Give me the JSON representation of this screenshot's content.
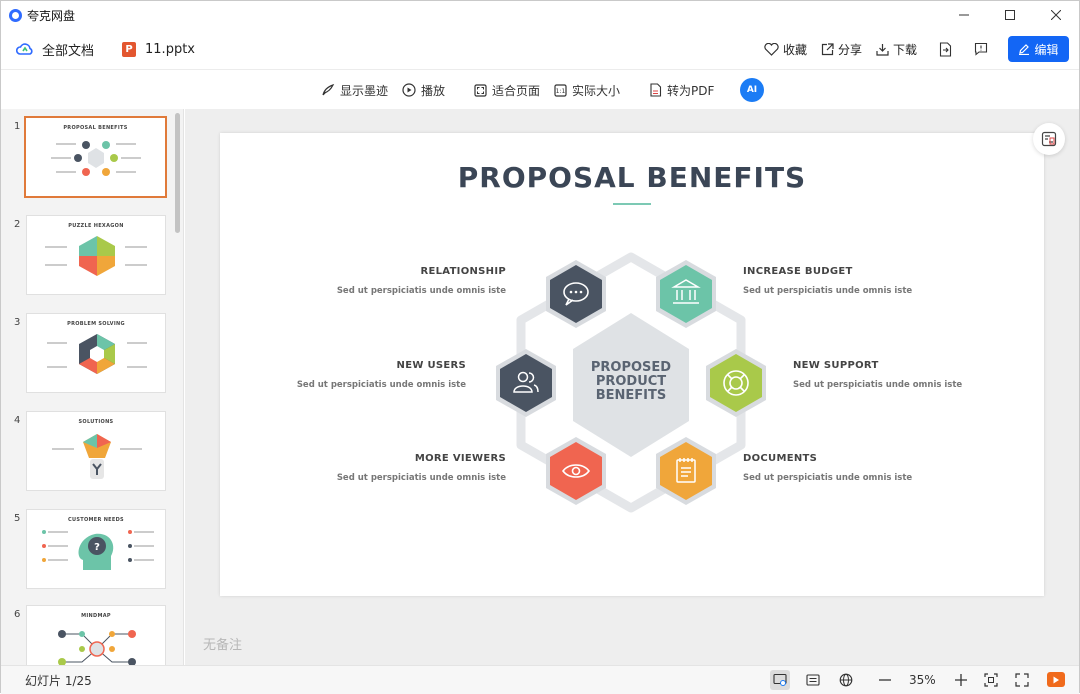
{
  "window": {
    "app_title": "夸克网盘"
  },
  "topbar": {
    "all_docs": "全部文档",
    "file_name": "11.pptx",
    "file_badge": "P",
    "favorite": "收藏",
    "share": "分享",
    "download": "下载",
    "edit": "编辑"
  },
  "toolbar": {
    "show_ink": "显示墨迹",
    "play": "播放",
    "fit_page": "适合页面",
    "actual_size": "实际大小",
    "to_pdf": "转为PDF",
    "ai_label": "AI"
  },
  "thumbnails": [
    {
      "num": "1",
      "title": "PROPOSAL BENEFITS"
    },
    {
      "num": "2",
      "title": "PUZZLE HEXAGON"
    },
    {
      "num": "3",
      "title": "PROBLEM SOLVING"
    },
    {
      "num": "4",
      "title": "SOLUTIONS"
    },
    {
      "num": "5",
      "title": "CUSTOMER NEEDS"
    },
    {
      "num": "6",
      "title": "MINDMAP"
    }
  ],
  "slide": {
    "title": "PROPOSAL BENEFITS",
    "center_line1": "PROPOSED",
    "center_line2": "PRODUCT",
    "center_line3": "BENEFITS",
    "items": {
      "relationship": {
        "title": "RELATIONSHIP",
        "desc": "Sed ut perspiciatis unde omnis iste"
      },
      "increase_budget": {
        "title": "INCREASE BUDGET",
        "desc": "Sed ut perspiciatis unde omnis iste"
      },
      "new_users": {
        "title": "NEW USERS",
        "desc": "Sed ut perspiciatis unde omnis iste"
      },
      "new_support": {
        "title": "NEW SUPPORT",
        "desc": "Sed ut perspiciatis unde omnis iste"
      },
      "more_viewers": {
        "title": "MORE VIEWERS",
        "desc": "Sed ut perspiciatis unde omnis iste"
      },
      "documents": {
        "title": "DOCUMENTS",
        "desc": "Sed ut perspiciatis unde omnis iste"
      }
    }
  },
  "notes_placeholder": "无备注",
  "status": {
    "slide_count": "幻灯片 1/25",
    "zoom": "35%"
  },
  "colors": {
    "accent": "#1366f5",
    "hex_dark": "#4a5462",
    "hex_teal": "#6cc4a8",
    "hex_green": "#a9c94a",
    "hex_orange": "#f0a63a",
    "hex_red": "#f06550",
    "hex_center": "#dfe2e5",
    "active_thumb": "#e07a3a"
  }
}
